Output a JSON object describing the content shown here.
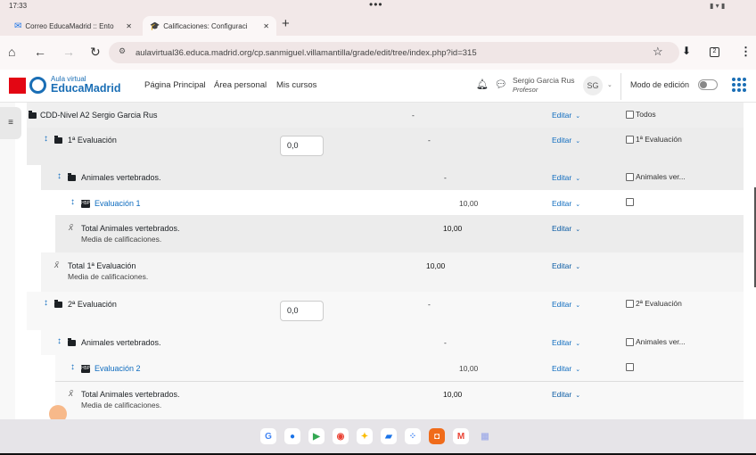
{
  "status_bar": {
    "time": "17:33"
  },
  "browser": {
    "tabs": [
      {
        "label": "Correo EducaMadrid :: Ento",
        "active": false
      },
      {
        "label": "Calificaciones: Configuraci",
        "active": true
      }
    ],
    "new_tab": "+",
    "url": "aulavirtual36.educa.madrid.org/cp.sanmiguel.villamantilla/grade/edit/tree/index.php?id=315",
    "tab_count": "2"
  },
  "header": {
    "logo_small": "Aula virtual",
    "logo_big": "EducaMadrid",
    "nav": [
      "Página Principal",
      "Área personal",
      "Mis cursos"
    ],
    "user_name": "Sergio Garcia Rus",
    "user_role": "Profesor",
    "initials": "SG",
    "edit_mode_label": "Modo de edición",
    "edit_mode_on": false
  },
  "grade_tree": {
    "rows": [
      {
        "type": "course",
        "name": "CDD-Nivel A2 Sergio Garcia Rus",
        "value": "-",
        "edit": "Editar",
        "checkbox_label": "Todos"
      },
      {
        "type": "category",
        "name": "1ª Evaluación",
        "weight": "0,0",
        "value": "-",
        "edit": "Editar",
        "checkbox_label": "1ª Evaluación"
      },
      {
        "type": "category",
        "name": "Animales vertebrados.",
        "value": "-",
        "edit": "Editar",
        "checkbox_label": "Animales ver..."
      },
      {
        "type": "item",
        "name": "Evaluación 1",
        "value": "10,00",
        "edit": "Editar",
        "checkbox_label": ""
      },
      {
        "type": "total",
        "name": "Total Animales vertebrados.",
        "sub": "Media de calificaciones.",
        "value": "10,00",
        "edit": "Editar"
      },
      {
        "type": "total",
        "name": "Total 1ª Evaluación",
        "sub": "Media de calificaciones.",
        "value": "10,00",
        "edit": "Editar"
      },
      {
        "type": "category",
        "name": "2ª Evaluación",
        "weight": "0,0",
        "value": "-",
        "edit": "Editar",
        "checkbox_label": "2ª Evaluación"
      },
      {
        "type": "category",
        "name": "Animales vertebrados.",
        "value": "-",
        "edit": "Editar",
        "checkbox_label": "Animales ver..."
      },
      {
        "type": "item",
        "name": "Evaluación 2",
        "value": "10,00",
        "edit": "Editar",
        "checkbox_label": ""
      },
      {
        "type": "total",
        "name": "Total Animales vertebrados.",
        "sub": "Media de calificaciones.",
        "value": "10,00",
        "edit": "Editar"
      }
    ]
  },
  "taskbar": {
    "apps": [
      "google-icon",
      "messages-icon",
      "play-store-icon",
      "chrome-icon",
      "photos-icon",
      "files-icon",
      "assistant-icon",
      "screen-recorder-icon",
      "gmail-icon",
      "app-drawer-icon"
    ]
  }
}
